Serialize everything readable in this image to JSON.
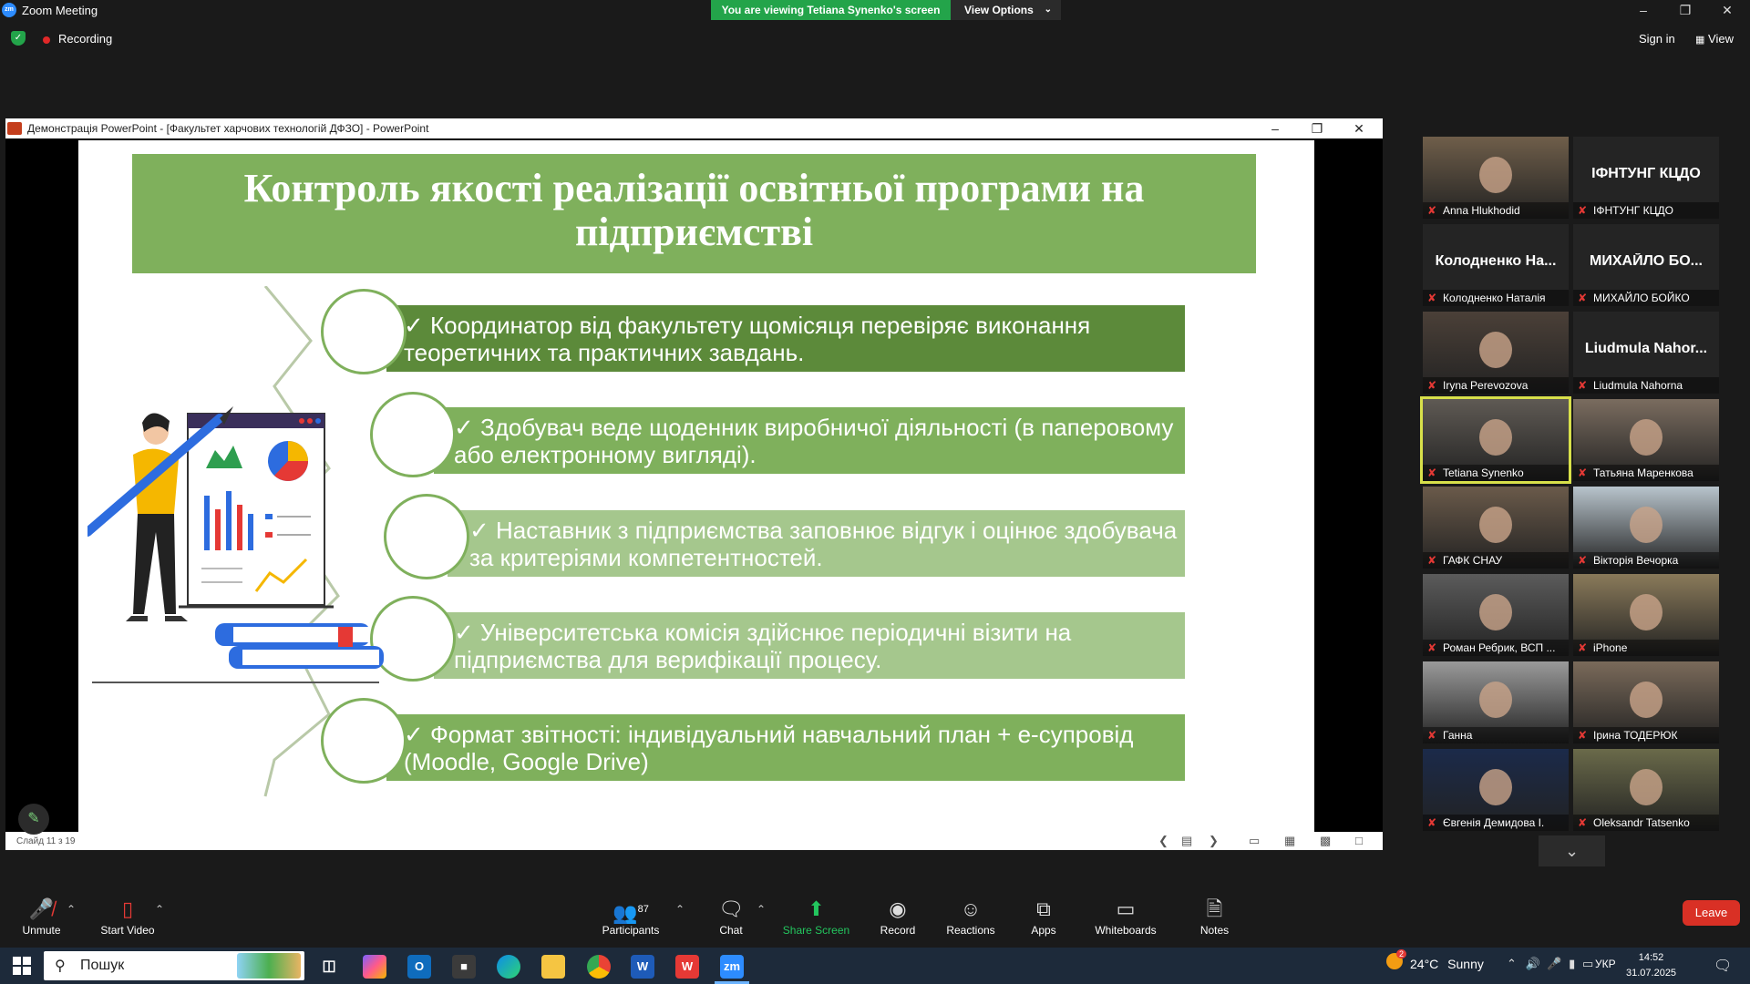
{
  "zoom": {
    "window_title": "Zoom Meeting",
    "logo_text": "zm",
    "share_banner": "You are viewing Tetiana Synenko's screen",
    "view_options": "View Options",
    "recording": "Recording",
    "sign_in": "Sign in",
    "view": "View"
  },
  "ppt": {
    "window_title": "Демонстрація PowerPoint - [Факультет харчових технологій ДФЗО] - PowerPoint",
    "slide_counter": "Слайд 11 з 19",
    "slide": {
      "title_line1": "Контроль якості реалізації освітньої програми на",
      "title_line2": "підприємстві",
      "items": [
        {
          "line1": "✓ Координатор від факультету щомісяця перевіряє виконання",
          "line2": "теоретичних та практичних завдань.",
          "color": "#5c8a3a"
        },
        {
          "line1": "✓ Здобувач веде щоденник виробничої діяльності (в паперовому",
          "line2": "або електронному вигляді).",
          "color": "#7fb05c"
        },
        {
          "line1": "✓ Наставник з підприємства заповнює відгук і оцінює здобувача",
          "line2": "за критеріями компетентностей.",
          "color": "#a5c78d"
        },
        {
          "line1": "✓ Університетська комісія здійснює періодичні візити на",
          "line2": "підприємства для верифікації процесу.",
          "color": "#a5c78d"
        },
        {
          "line1": "✓ Формат звітності: індивідуальний навчальний план + е-супровід",
          "line2": "(Moodle, Google Drive)",
          "color": "#7fb05c"
        }
      ]
    }
  },
  "gallery": [
    {
      "name": "Anna Hlukhodid",
      "video": true
    },
    {
      "name": "ІФНТУНГ КЦДО",
      "display": "ІФНТУНГ КЦДО",
      "video": false
    },
    {
      "name": "Колодненко Наталія",
      "display": "Колодненко  На...",
      "video": false
    },
    {
      "name": "МИХАЙЛО БОЙКО",
      "display": "МИХАЙЛО  БО...",
      "video": false
    },
    {
      "name": "Iryna Perevozova",
      "video": true
    },
    {
      "name": "Liudmula Nahorna",
      "display": "Liudmula  Nahor...",
      "video": false
    },
    {
      "name": "Tetiana Synenko",
      "video": true,
      "active": true
    },
    {
      "name": "Татьяна Маренкова",
      "video": true
    },
    {
      "name": "ГАФК СНАУ",
      "video": true
    },
    {
      "name": "Вікторія Вечорка",
      "video": true
    },
    {
      "name": "Роман Ребрик, ВСП ...",
      "video": true
    },
    {
      "name": "iPhone",
      "video": true
    },
    {
      "name": "Ганна",
      "video": true
    },
    {
      "name": "Ірина ТОДЕРЮК",
      "video": true
    },
    {
      "name": "Євгенія Демидова І.",
      "video": true
    },
    {
      "name": "Oleksandr Tatsenko",
      "video": true
    }
  ],
  "toolbar": {
    "unmute": "Unmute",
    "start_video": "Start Video",
    "participants": "Participants",
    "participants_count": "87",
    "chat": "Chat",
    "share_screen": "Share Screen",
    "record": "Record",
    "reactions": "Reactions",
    "apps": "Apps",
    "whiteboards": "Whiteboards",
    "notes": "Notes",
    "leave": "Leave"
  },
  "taskbar": {
    "search_placeholder": "Пошук",
    "weather_temp": "24°C",
    "weather_desc": "Sunny",
    "weather_badge": "2",
    "language": "УКР",
    "time": "14:52",
    "date": "31.07.2025"
  }
}
